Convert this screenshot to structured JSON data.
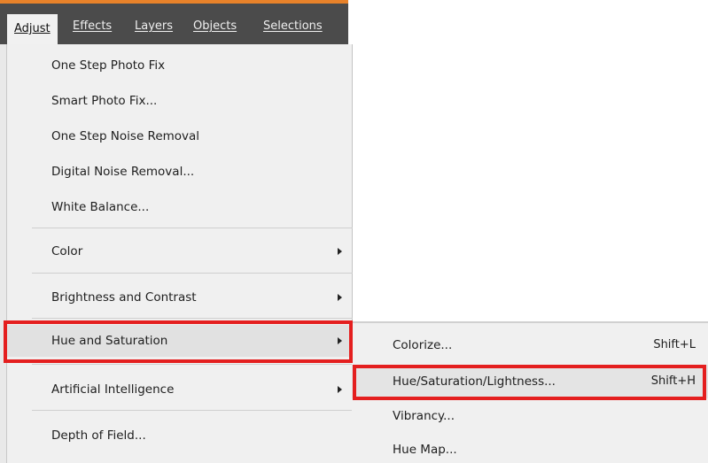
{
  "menubar": {
    "items": [
      {
        "label": "Adjust"
      },
      {
        "label": "Effects"
      },
      {
        "label": "Layers"
      },
      {
        "label": "Objects"
      },
      {
        "label": "Selections"
      }
    ]
  },
  "adjust_menu": {
    "items": [
      {
        "label": "One Step Photo Fix"
      },
      {
        "label": "Smart Photo Fix..."
      },
      {
        "label": "One Step Noise Removal"
      },
      {
        "label": "Digital Noise Removal..."
      },
      {
        "label": "White Balance..."
      },
      {
        "label": "Color"
      },
      {
        "label": "Brightness and Contrast"
      },
      {
        "label": "Hue and Saturation"
      },
      {
        "label": "Artificial Intelligence"
      },
      {
        "label": "Depth of Field..."
      }
    ]
  },
  "hue_submenu": {
    "items": [
      {
        "label": "Colorize...",
        "shortcut": "Shift+L"
      },
      {
        "label": "Hue/Saturation/Lightness...",
        "shortcut": "Shift+H"
      },
      {
        "label": "Vibrancy..."
      },
      {
        "label": "Hue Map..."
      }
    ]
  },
  "colors": {
    "menubar_bg": "#4b4b4b",
    "menubar_accent": "#e8822a",
    "menu_bg": "#f0f0f0",
    "highlight_box": "#e41f1f"
  }
}
